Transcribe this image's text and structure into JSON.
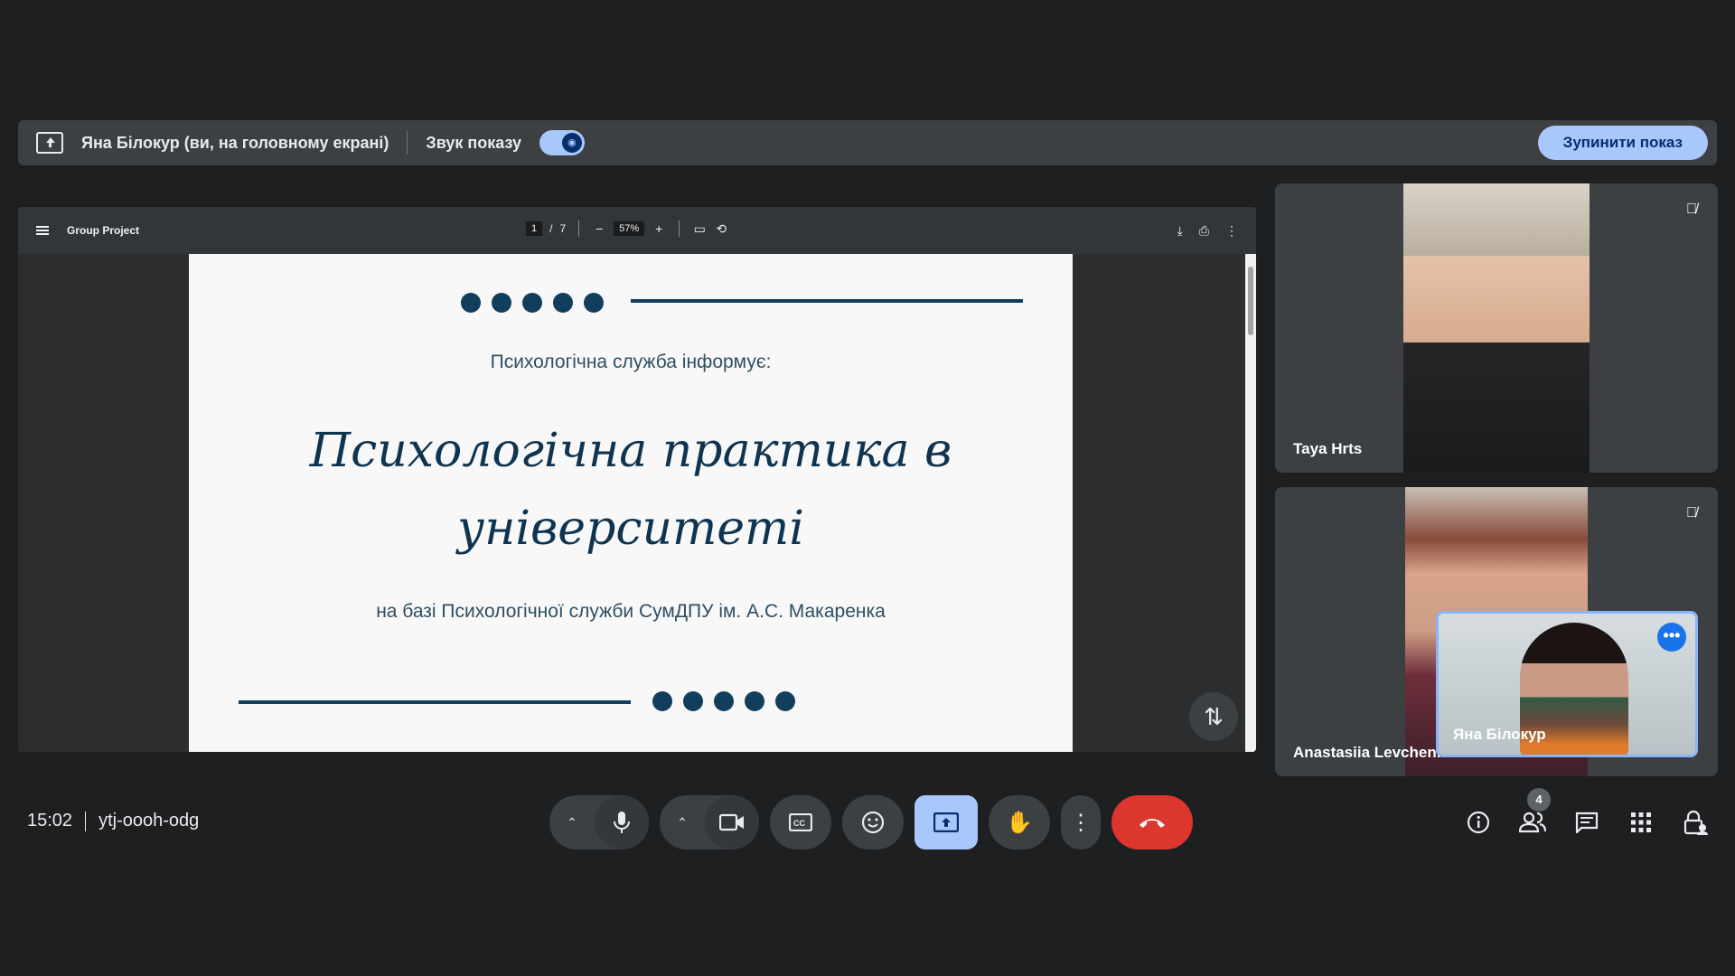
{
  "banner": {
    "presenter_text": "Яна Білокур (ви, на головному екрані)",
    "sound_label": "Звук показу",
    "sound_on": true,
    "stop_label": "Зупинити показ"
  },
  "pdf": {
    "title": "Group Project",
    "page_current": "1",
    "page_sep": "/",
    "page_total": "7",
    "zoom": "57%",
    "minus": "−",
    "plus": "+"
  },
  "slide": {
    "subtitle": "Психологічна служба інформує:",
    "title_line1": "Психологічна практика в",
    "title_line2": "університеті",
    "footer": "на базі Психологічної служби СумДПУ ім. А.С. Макаренка"
  },
  "participants": [
    {
      "name": "Taya Hrts",
      "muted": true
    },
    {
      "name": "Anastasiia Levchenko",
      "muted": true
    },
    {
      "name": "Яна Білокур",
      "self": true
    }
  ],
  "meeting": {
    "time": "15:02",
    "code": "ytj-oooh-odg",
    "participant_count": "4"
  },
  "icons": {
    "mic": "mic-icon",
    "camera": "camera-icon",
    "captions": "captions-icon",
    "emoji": "emoji-icon",
    "present": "present-icon",
    "raise_hand": "hand-icon",
    "more": "more-vert-icon",
    "end_call": "end-call-icon",
    "info": "info-icon",
    "people": "people-icon",
    "chat": "chat-icon",
    "activities": "apps-icon",
    "host_controls": "lock-person-icon"
  },
  "colors": {
    "accent": "#a8c7fa",
    "end_call": "#dc362e",
    "slide_navy": "#113e5c",
    "pip_border": "#8ab4f8"
  }
}
